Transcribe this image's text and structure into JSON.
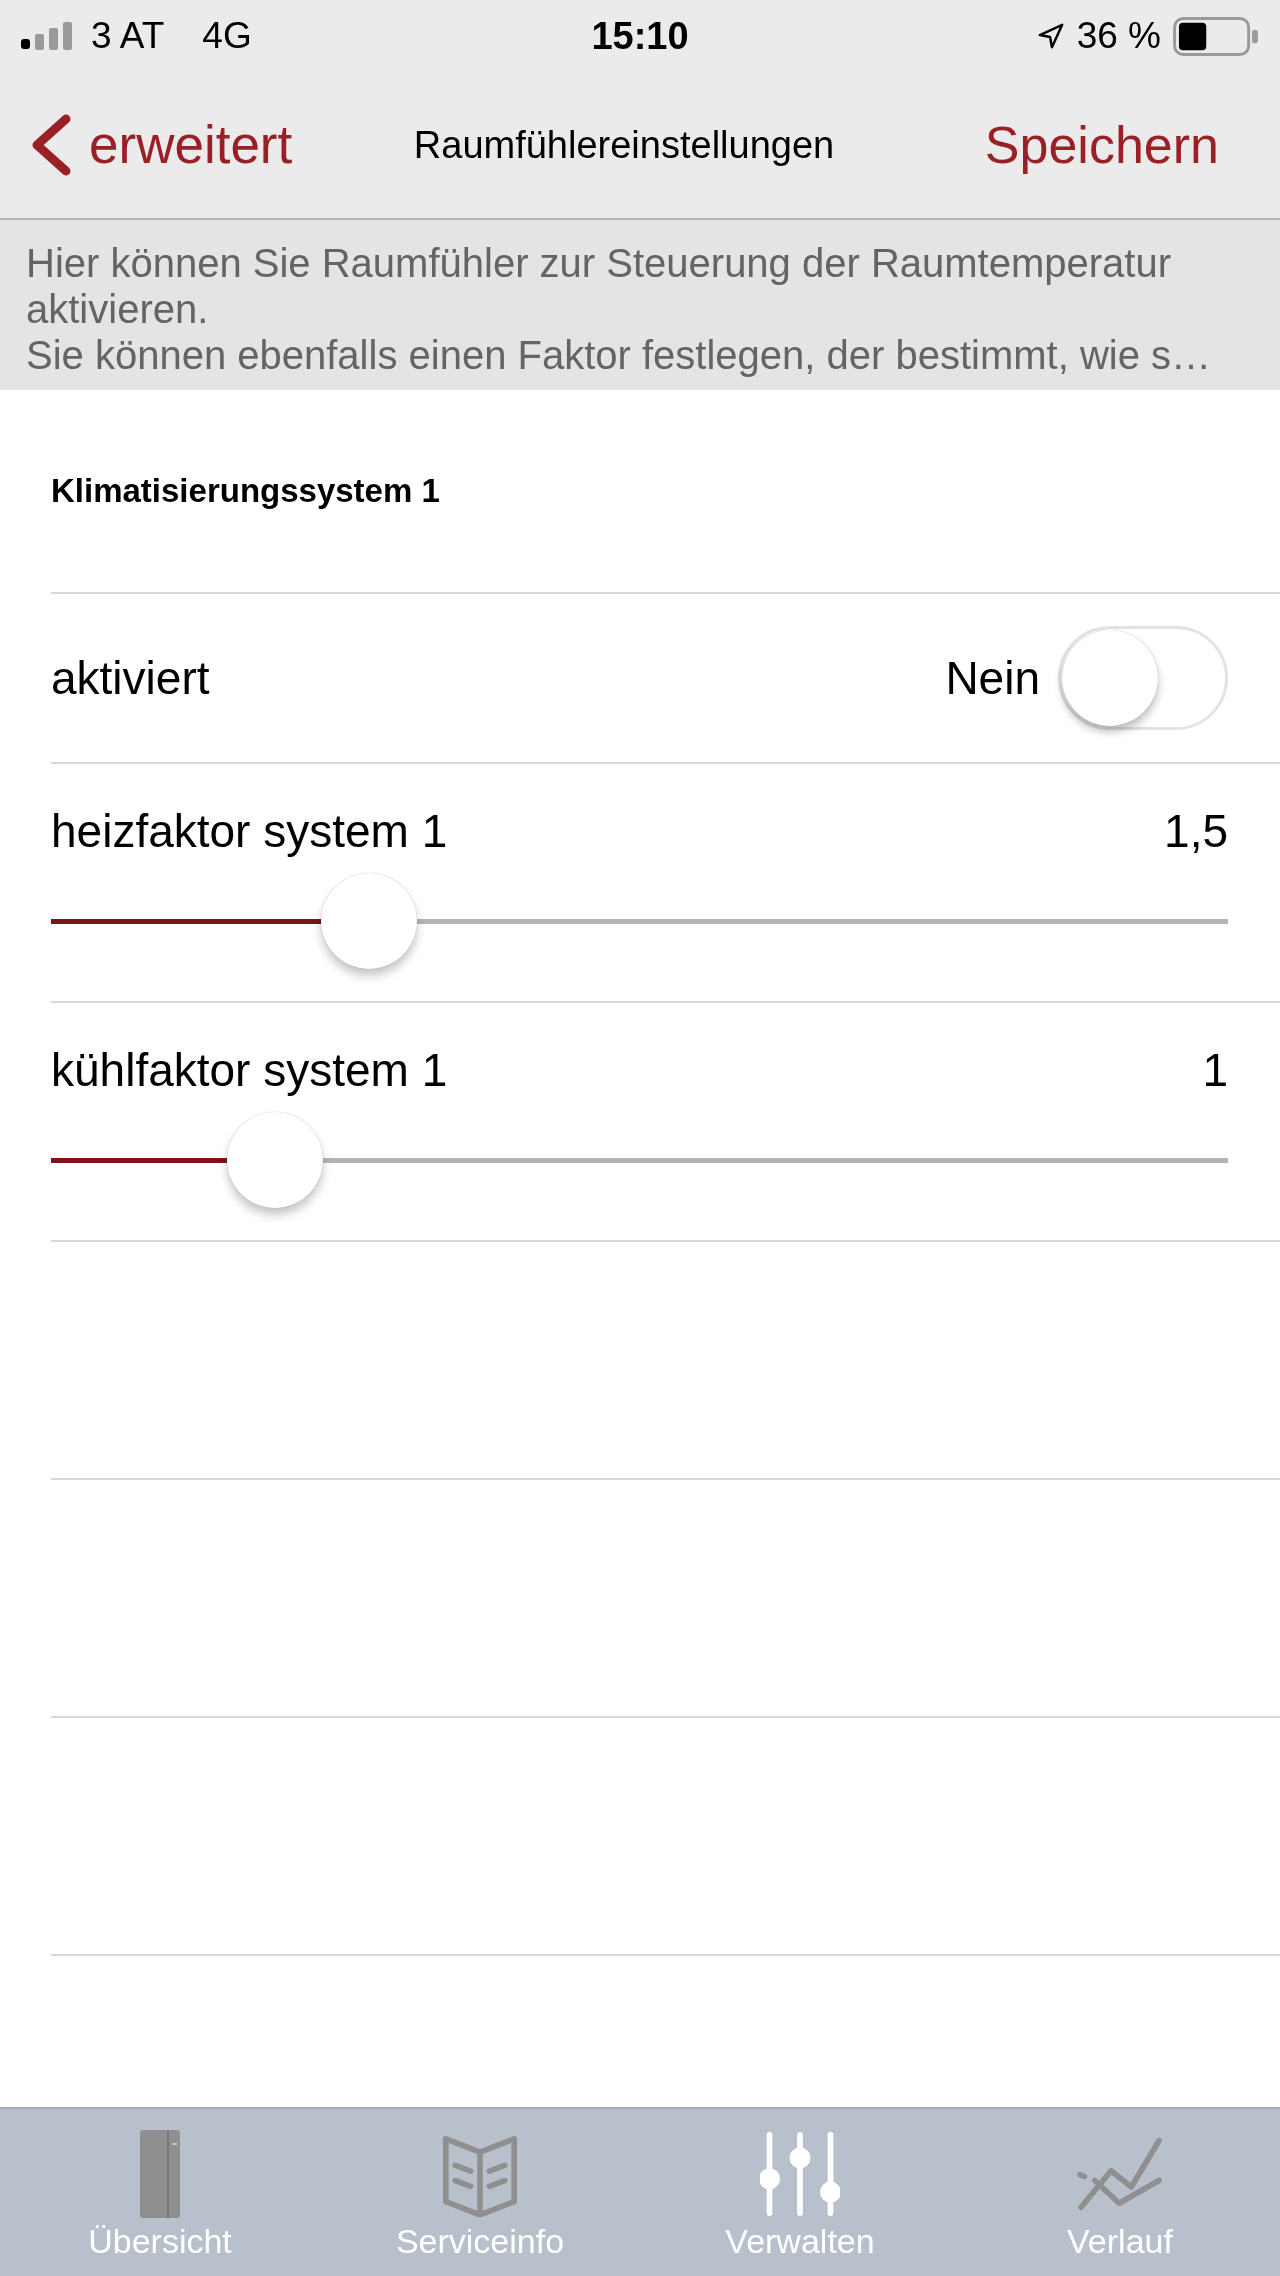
{
  "status_bar": {
    "carrier": "3 AT",
    "network": "4G",
    "time": "15:10",
    "battery": "36 %"
  },
  "nav_bar": {
    "back": "erweitert",
    "title": "Raumfühlereinstellungen",
    "action": "Speichern"
  },
  "description": [
    "Hier können Sie Raumfühler zur Steuerung der Raumtemperatur aktivieren.",
    "Sie können ebenfalls einen Faktor festlegen, der bestimmt, wie s…"
  ],
  "section": {
    "title": "Klimatisierungssystem 1"
  },
  "settings": [
    {
      "kind": "toggle",
      "label": "aktiviert",
      "value": "Nein",
      "on": false
    },
    {
      "kind": "slider",
      "label": "heizfaktor system 1",
      "value": "1,5",
      "level": 0.27
    },
    {
      "kind": "slider",
      "label": "kühlfaktor system 1",
      "value": "1",
      "level": 0.19
    }
  ],
  "tab_bar": [
    {
      "label": "Übersicht",
      "selected": false
    },
    {
      "label": "Serviceinfo",
      "selected": false
    },
    {
      "label": "Verwalten",
      "selected": true
    },
    {
      "label": "Verlauf",
      "selected": false
    }
  ]
}
